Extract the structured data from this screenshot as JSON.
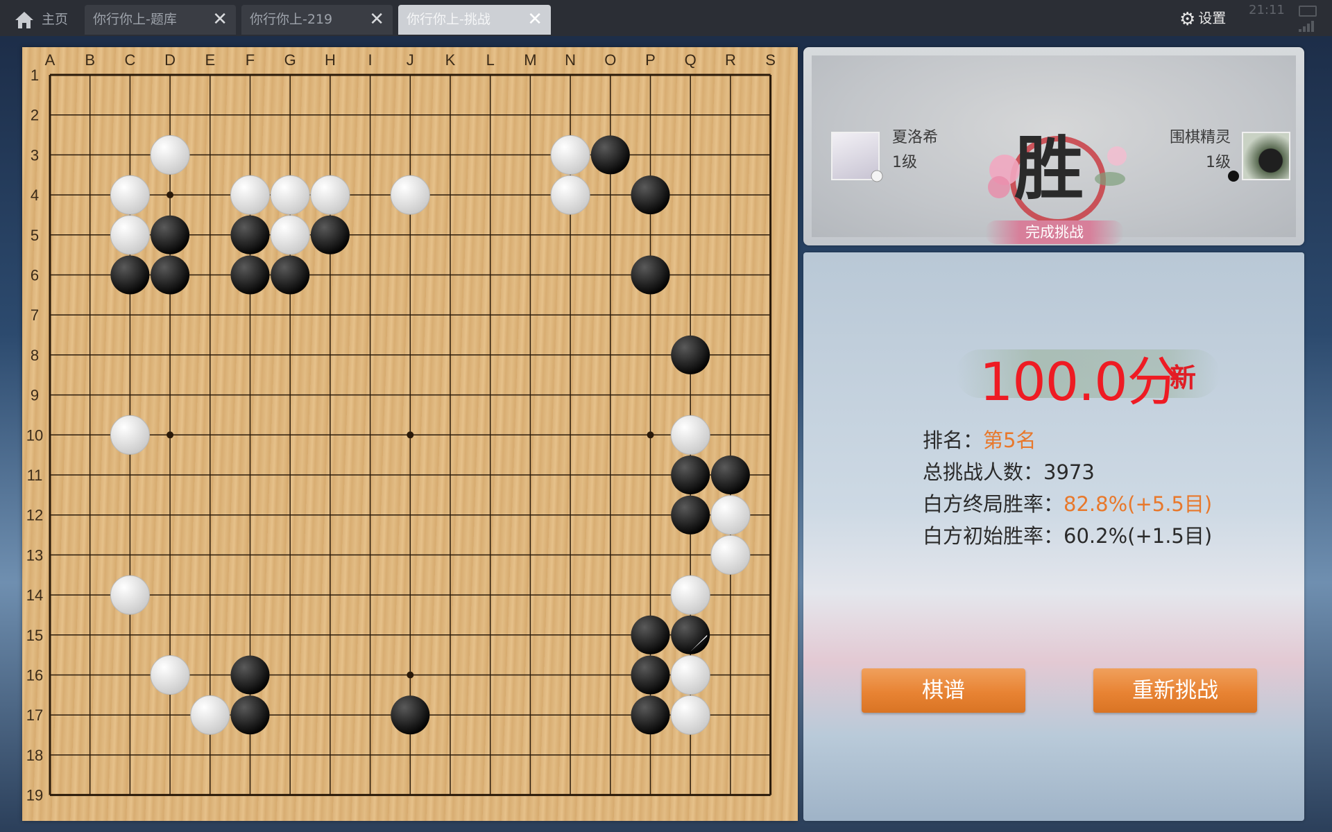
{
  "tabs": {
    "home": "主页",
    "t1": "你行你上-题库",
    "t2": "你行你上-219",
    "t3": "你行你上-挑战"
  },
  "settings_label": "设置",
  "clock": "21:11",
  "board": {
    "columns": [
      "A",
      "B",
      "C",
      "D",
      "E",
      "F",
      "G",
      "H",
      "I",
      "J",
      "K",
      "L",
      "M",
      "N",
      "O",
      "P",
      "Q",
      "R",
      "S"
    ],
    "rows": [
      "1",
      "2",
      "3",
      "4",
      "5",
      "6",
      "7",
      "8",
      "9",
      "10",
      "11",
      "12",
      "13",
      "14",
      "15",
      "16",
      "17",
      "18",
      "19"
    ],
    "last_move": "Q15",
    "black": [
      "D5",
      "D6",
      "C6",
      "F5",
      "F6",
      "G6",
      "H5",
      "O3",
      "P4",
      "P6",
      "Q8",
      "Q11",
      "R11",
      "Q12",
      "P15",
      "Q15",
      "P16",
      "P17",
      "F16",
      "F17",
      "J17"
    ],
    "white": [
      "D3",
      "C4",
      "C5",
      "F4",
      "G4",
      "G5",
      "H4",
      "J4",
      "N3",
      "N4",
      "C10",
      "Q10",
      "R12",
      "R13",
      "C14",
      "Q14",
      "Q16",
      "Q17",
      "D16",
      "E17"
    ]
  },
  "result": {
    "player_left": {
      "name": "夏洛希",
      "level": "1级"
    },
    "player_right": {
      "name": "围棋精灵",
      "level": "1级"
    },
    "win_char": "胜",
    "win_sub": "完成挑战"
  },
  "stats": {
    "score": "100.0分",
    "new_tag": "新",
    "rank_label": "排名：",
    "rank_value": "第5名",
    "total_label": "总挑战人数：",
    "total_value": "3973",
    "final_label": "白方终局胜率：",
    "final_value": "82.8%(+5.5目)",
    "initial_label": "白方初始胜率：",
    "initial_value": "60.2%(+1.5目)"
  },
  "buttons": {
    "record": "棋谱",
    "retry": "重新挑战"
  },
  "colors": {
    "score_red": "#ee1b23",
    "highlight_orange": "#e8782b",
    "button_orange": "#e88333",
    "board_wood": "#dcb37a"
  }
}
